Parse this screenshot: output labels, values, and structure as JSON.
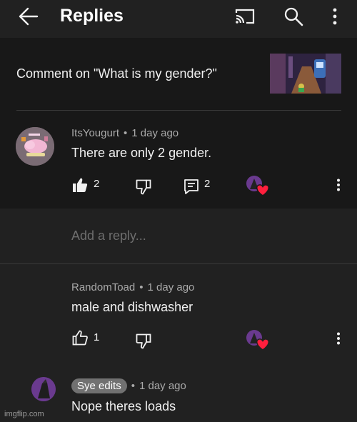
{
  "header": {
    "title": "Replies",
    "icons": [
      "back-arrow-icon",
      "cast-icon",
      "search-icon",
      "more-vertical-icon"
    ]
  },
  "parent_comment": {
    "context_text": "Comment on \"What is my gender?\"",
    "author": "ItsYougurt",
    "separator": "•",
    "time": "1 day ago",
    "text": "There are only 2 gender.",
    "like_count": "2",
    "reply_count": "2"
  },
  "reply_input": {
    "placeholder": "Add a reply..."
  },
  "replies": [
    {
      "author": "RandomToad",
      "separator": "•",
      "time": "1 day ago",
      "text": "male and dishwasher",
      "like_count": "1"
    },
    {
      "author": "Sye edits",
      "separator": "•",
      "time": "1 day ago",
      "text": "Nope theres loads"
    }
  ],
  "watermark": "imgflip.com",
  "colors": {
    "background": "#212121",
    "parent_background": "#181818",
    "heart": "#ff1f3d",
    "muted_text": "#aaaaaa"
  }
}
